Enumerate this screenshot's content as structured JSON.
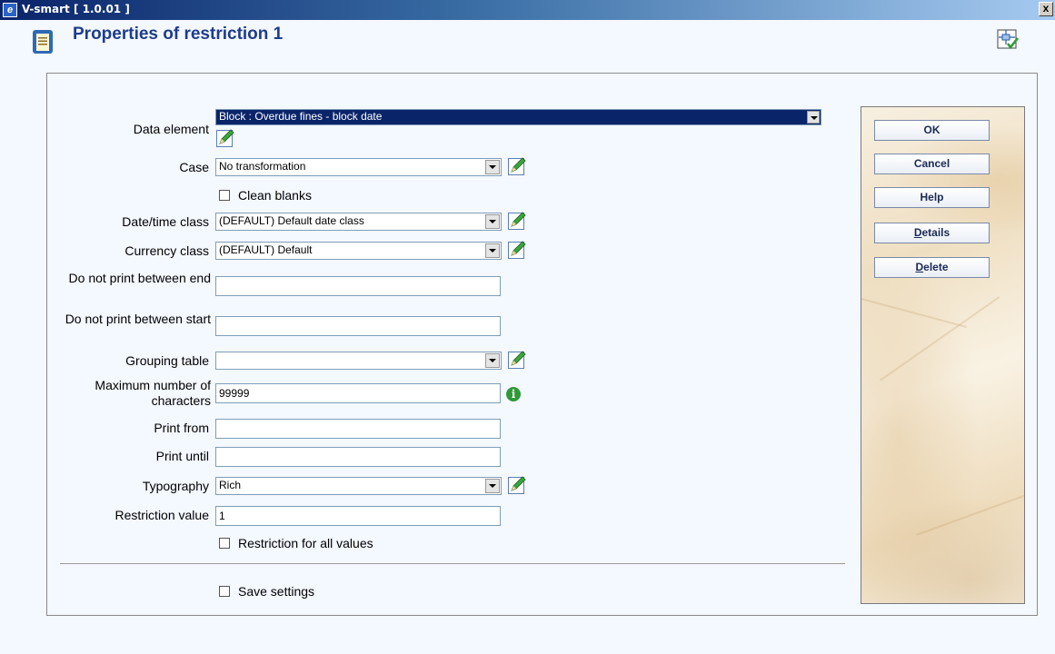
{
  "window": {
    "title": "V-smart [ 1.0.01 ]",
    "close_label": "x"
  },
  "header": {
    "title": "Properties of restriction 1"
  },
  "form": {
    "data_element": {
      "label": "Data element",
      "value": "Block : Overdue fines - block date"
    },
    "case": {
      "label": "Case",
      "value": "No transformation"
    },
    "clean_blanks": {
      "label": "Clean blanks",
      "checked": false
    },
    "datetime_class": {
      "label": "Date/time class",
      "value": "(DEFAULT) Default date class"
    },
    "currency_class": {
      "label": "Currency class",
      "value": "(DEFAULT) Default"
    },
    "do_not_print_end": {
      "label": "Do not print between end",
      "value": ""
    },
    "do_not_print_start": {
      "label": "Do not print between start",
      "value": ""
    },
    "grouping_table": {
      "label": "Grouping table",
      "value": ""
    },
    "max_chars": {
      "label": "Maximum number of characters",
      "value": "99999"
    },
    "print_from": {
      "label": "Print from",
      "value": ""
    },
    "print_until": {
      "label": "Print until",
      "value": ""
    },
    "typography": {
      "label": "Typography",
      "value": "Rich"
    },
    "restriction_value": {
      "label": "Restriction value",
      "value": "1"
    },
    "restriction_all": {
      "label": "Restriction for all values",
      "checked": false
    },
    "save_settings": {
      "label": "Save settings",
      "checked": false
    }
  },
  "buttons": {
    "ok": "OK",
    "cancel": "Cancel",
    "help": "Help",
    "details_first": "D",
    "details_rest": "etails",
    "delete_first": "D",
    "delete_rest": "elete"
  },
  "icons": {
    "app": "v-smart-app-icon",
    "form": "clipboard-icon",
    "corner": "flow-check-icon",
    "edit": "pencil-edit-icon",
    "info": "info-icon"
  },
  "colors": {
    "title_text": "#1d3c8c",
    "highlight": "#0a246a",
    "info": "#2f9a37"
  }
}
